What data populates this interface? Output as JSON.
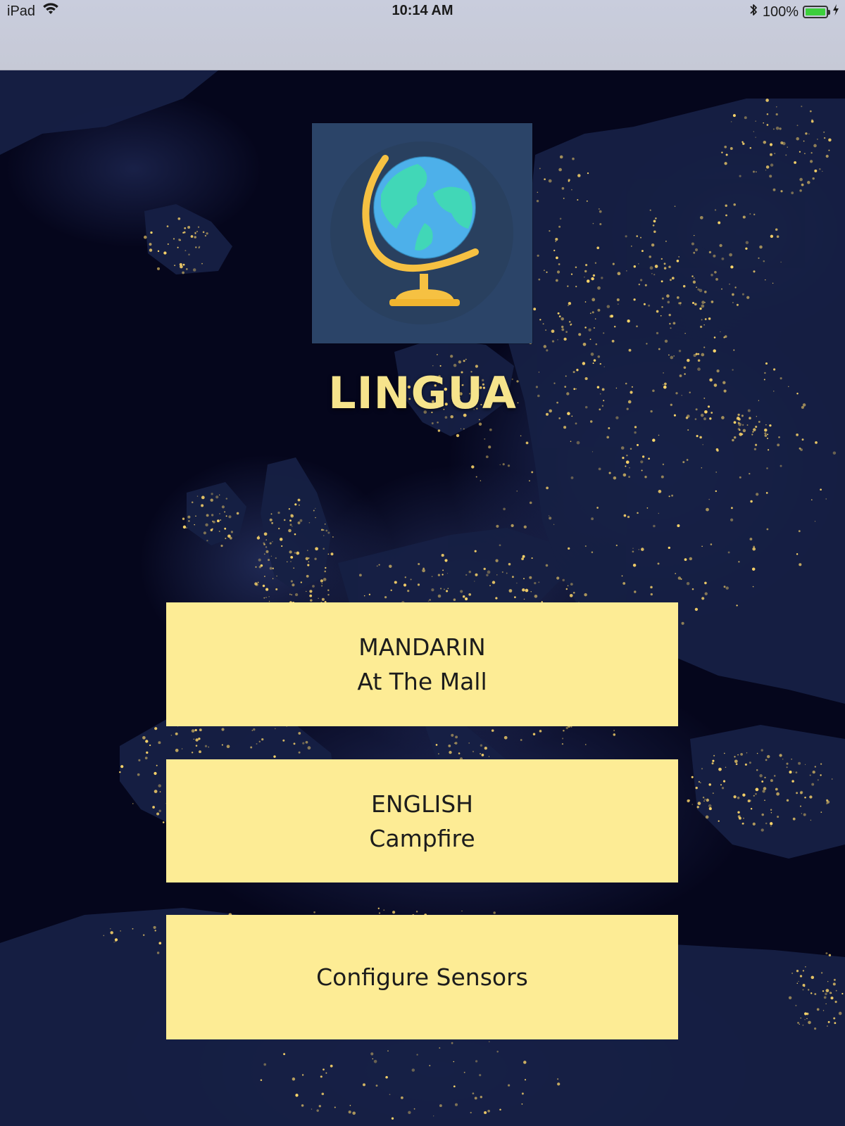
{
  "status_bar": {
    "device": "iPad",
    "time": "10:14 AM",
    "battery": "100%"
  },
  "app": {
    "title": "LINGUA",
    "logo_icon": "globe-icon"
  },
  "menu": [
    {
      "line1": "MANDARIN",
      "line2": "At The Mall"
    },
    {
      "line1": "ENGLISH",
      "line2": "Campfire"
    },
    {
      "line1": "Configure Sensors"
    }
  ],
  "colors": {
    "button_bg": "#fdec95",
    "title": "#f6e48c",
    "logo_bg": "#2b4468",
    "map_bg": "#05061c"
  }
}
